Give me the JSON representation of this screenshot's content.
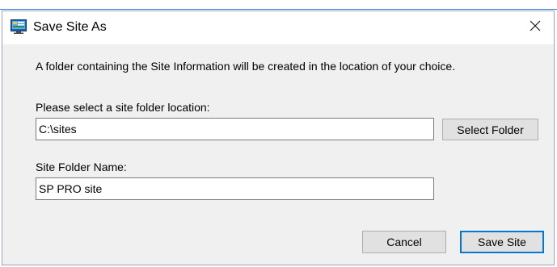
{
  "window": {
    "title": "Save Site As",
    "app_icon": "save-site-app-icon",
    "close_icon": "close-icon"
  },
  "info_text": "A folder containing the Site Information will be created in the location of your choice.",
  "location": {
    "label": "Please select a site folder location:",
    "value": "C:\\sites",
    "select_button_label": "Select Folder"
  },
  "folder_name": {
    "label": "Site Folder Name:",
    "value": "SP PRO site"
  },
  "buttons": {
    "cancel_label": "Cancel",
    "save_label": "Save Site"
  },
  "colors": {
    "accent": "#0078d7",
    "dialog_background": "#f0f0f0",
    "button_background": "#e1e1e1"
  }
}
